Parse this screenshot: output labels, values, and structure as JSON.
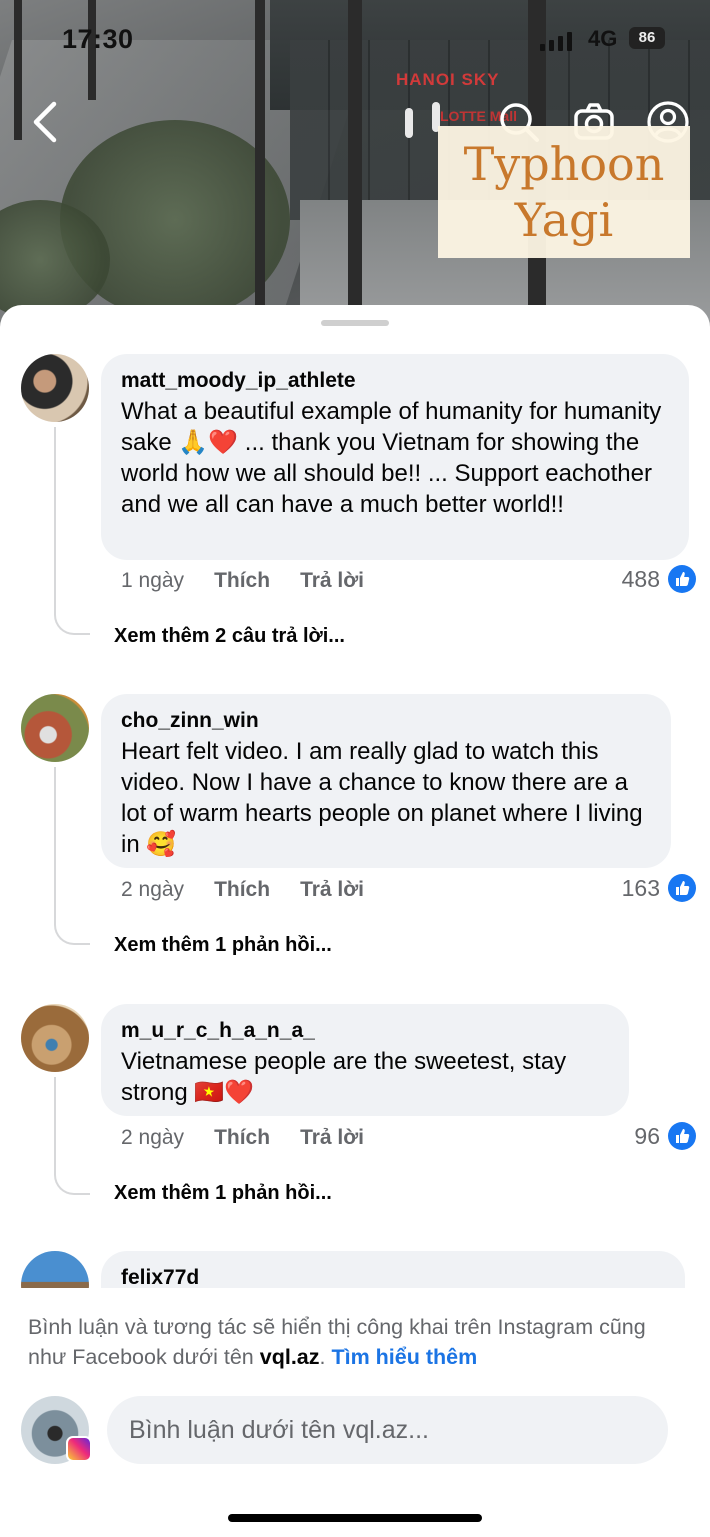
{
  "status_bar": {
    "time": "17:30",
    "network": "4G",
    "battery": "86"
  },
  "video_overlay": {
    "title_line1": "Typhoon",
    "title_line2": "Yagi",
    "sign_text": "HANOI SKY",
    "sign_text2": "LOTTE Mall"
  },
  "icons": {
    "back": "chevron-left-icon",
    "search": "search-icon",
    "camera": "camera-icon",
    "profile": "profile-icon",
    "like": "like-thumb-icon"
  },
  "colors": {
    "bubble": "#f0f2f5",
    "link": "#1b74e4",
    "like_blue": "#1877f2",
    "overlay_text": "#c8782c"
  },
  "comments": [
    {
      "author": "matt_moody_ip_athlete",
      "text": "What a beautiful example of humanity for humanity sake 🙏❤️ ... thank you Vietnam for showing the world how we all should be!! ... Support eachother and we all can have a much better world!!",
      "time": "1 ngày",
      "like_label": "Thích",
      "reply_label": "Trả lời",
      "likes": "488",
      "more_replies": "Xem thêm 2 câu trả lời..."
    },
    {
      "author": "cho_zinn_win",
      "text": "Heart felt video. I am really glad to watch this video. Now I have a chance to know there are a lot of warm hearts people on planet where I living in 🥰",
      "time": "2 ngày",
      "like_label": "Thích",
      "reply_label": "Trả lời",
      "likes": "163",
      "more_replies": "Xem thêm 1 phản hồi..."
    },
    {
      "author": "m_u_r_c_h_a_n_a_",
      "text": "Vietnamese people are the sweetest, stay strong 🇻🇳❤️",
      "time": "2 ngày",
      "like_label": "Thích",
      "reply_label": "Trả lời",
      "likes": "96",
      "more_replies": "Xem thêm 1 phản hồi..."
    },
    {
      "author": "felix77d"
    }
  ],
  "footer": {
    "notice_text": "Bình luận và tương tác sẽ hiển thị công khai trên Instagram cũng như Facebook dưới tên",
    "username": "vql.az",
    "period": ".",
    "learn_more": "Tìm hiểu thêm",
    "input_placeholder": "Bình luận dưới tên vql.az..."
  }
}
